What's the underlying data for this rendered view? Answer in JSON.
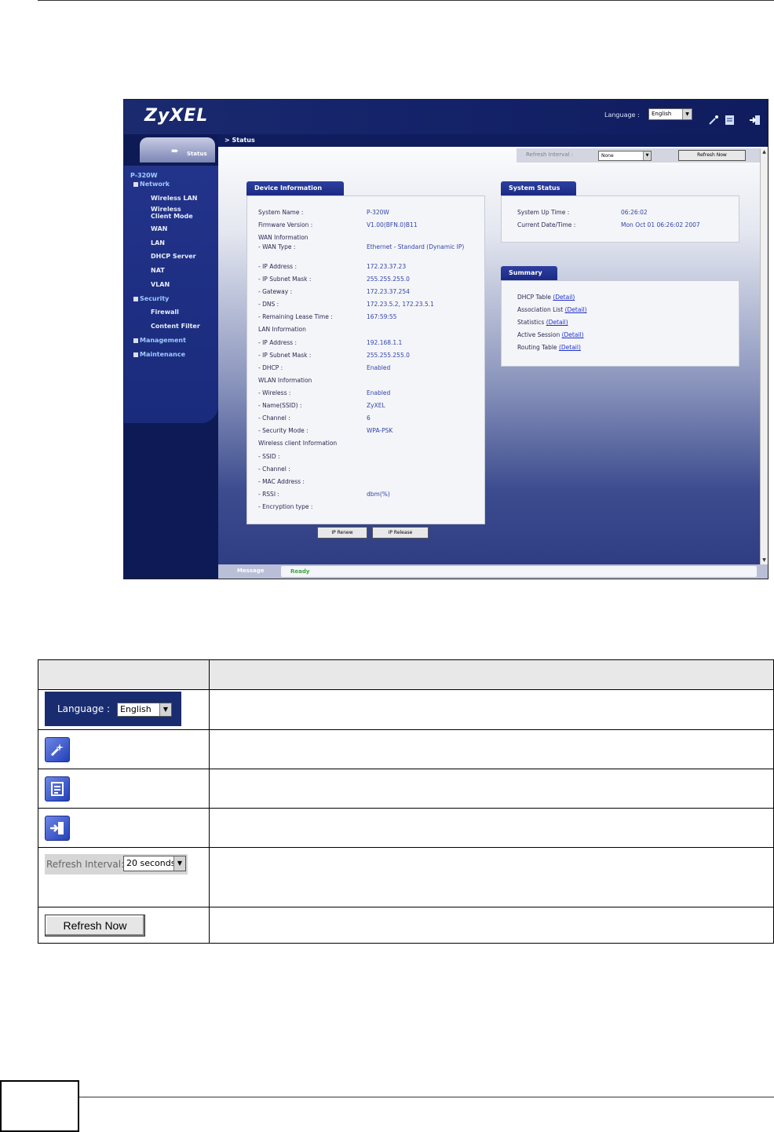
{
  "screenshot": {
    "logo": "ZyXEL",
    "language_label": "Language :",
    "language_value": "English",
    "status_tab": "Status",
    "breadcrumb": "> Status",
    "refresh_interval_label": "Refresh Interval :",
    "refresh_interval_value": "None",
    "refresh_now": "Refresh Now",
    "nav": {
      "root": "P-320W",
      "network": "Network",
      "wireless_lan": "Wireless LAN",
      "wireless_client_mode": "Wireless\nClient Mode",
      "wan": "WAN",
      "lan": "LAN",
      "dhcp_server": "DHCP Server",
      "nat": "NAT",
      "vlan": "VLAN",
      "security": "Security",
      "firewall": "Firewall",
      "content_filter": "Content Filter",
      "management": "Management",
      "maintenance": "Maintenance"
    },
    "device_info": {
      "title": "Device Information",
      "rows": [
        {
          "label": "System Name :",
          "value": "P-320W"
        },
        {
          "label": "Firmware Version :",
          "value": "V1.00(BFN.0)B11"
        },
        {
          "label": "WAN Information",
          "value": ""
        },
        {
          "label": "- WAN Type :",
          "value": "Ethernet - Standard (Dynamic IP)"
        },
        {
          "label": "- IP Address :",
          "value": "172.23.37.23"
        },
        {
          "label": "- IP Subnet Mask :",
          "value": "255.255.255.0"
        },
        {
          "label": "- Gateway :",
          "value": "172.23.37.254"
        },
        {
          "label": "- DNS :",
          "value": "172.23.5.2, 172.23.5.1"
        },
        {
          "label": "- Remaining Lease Time :",
          "value": "167:59:55"
        },
        {
          "label": "LAN Information",
          "value": ""
        },
        {
          "label": "- IP Address :",
          "value": "192.168.1.1"
        },
        {
          "label": "- IP Subnet Mask :",
          "value": "255.255.255.0"
        },
        {
          "label": "- DHCP :",
          "value": "Enabled"
        },
        {
          "label": "WLAN Information",
          "value": ""
        },
        {
          "label": "- Wireless :",
          "value": "Enabled"
        },
        {
          "label": "- Name(SSID) :",
          "value": "ZyXEL"
        },
        {
          "label": "- Channel :",
          "value": "6"
        },
        {
          "label": "- Security Mode :",
          "value": "WPA-PSK"
        },
        {
          "label": "Wireless client Information",
          "value": ""
        },
        {
          "label": "- SSID :",
          "value": ""
        },
        {
          "label": "- Channel :",
          "value": ""
        },
        {
          "label": "- MAC Address :",
          "value": ""
        },
        {
          "label": "- RSSI :",
          "value": "dbm(%)"
        },
        {
          "label": "- Encryption type :",
          "value": ""
        }
      ]
    },
    "system_status": {
      "title": "System Status",
      "rows": [
        {
          "label": "System Up Time :",
          "value": "06:26:02"
        },
        {
          "label": "Current Date/Time :",
          "value": "Mon Oct 01 06:26:02 2007"
        }
      ]
    },
    "summary": {
      "title": "Summary",
      "rows": [
        {
          "label": "DHCP Table",
          "link": "(Detail)"
        },
        {
          "label": "Association List",
          "link": "(Detail)"
        },
        {
          "label": "Statistics",
          "link": "(Detail)"
        },
        {
          "label": "Active Session",
          "link": "(Detail)"
        },
        {
          "label": "Routing Table",
          "link": "(Detail)"
        }
      ]
    },
    "ip_renew": "IP Renew",
    "ip_release": "IP Release",
    "message_label": "Message",
    "message_value": "Ready"
  },
  "table": {
    "lang_label": "Language :",
    "lang_value": "English",
    "refresh_label": "Refresh Interval:",
    "refresh_value": "20 seconds",
    "refresh_now": "Refresh Now"
  }
}
